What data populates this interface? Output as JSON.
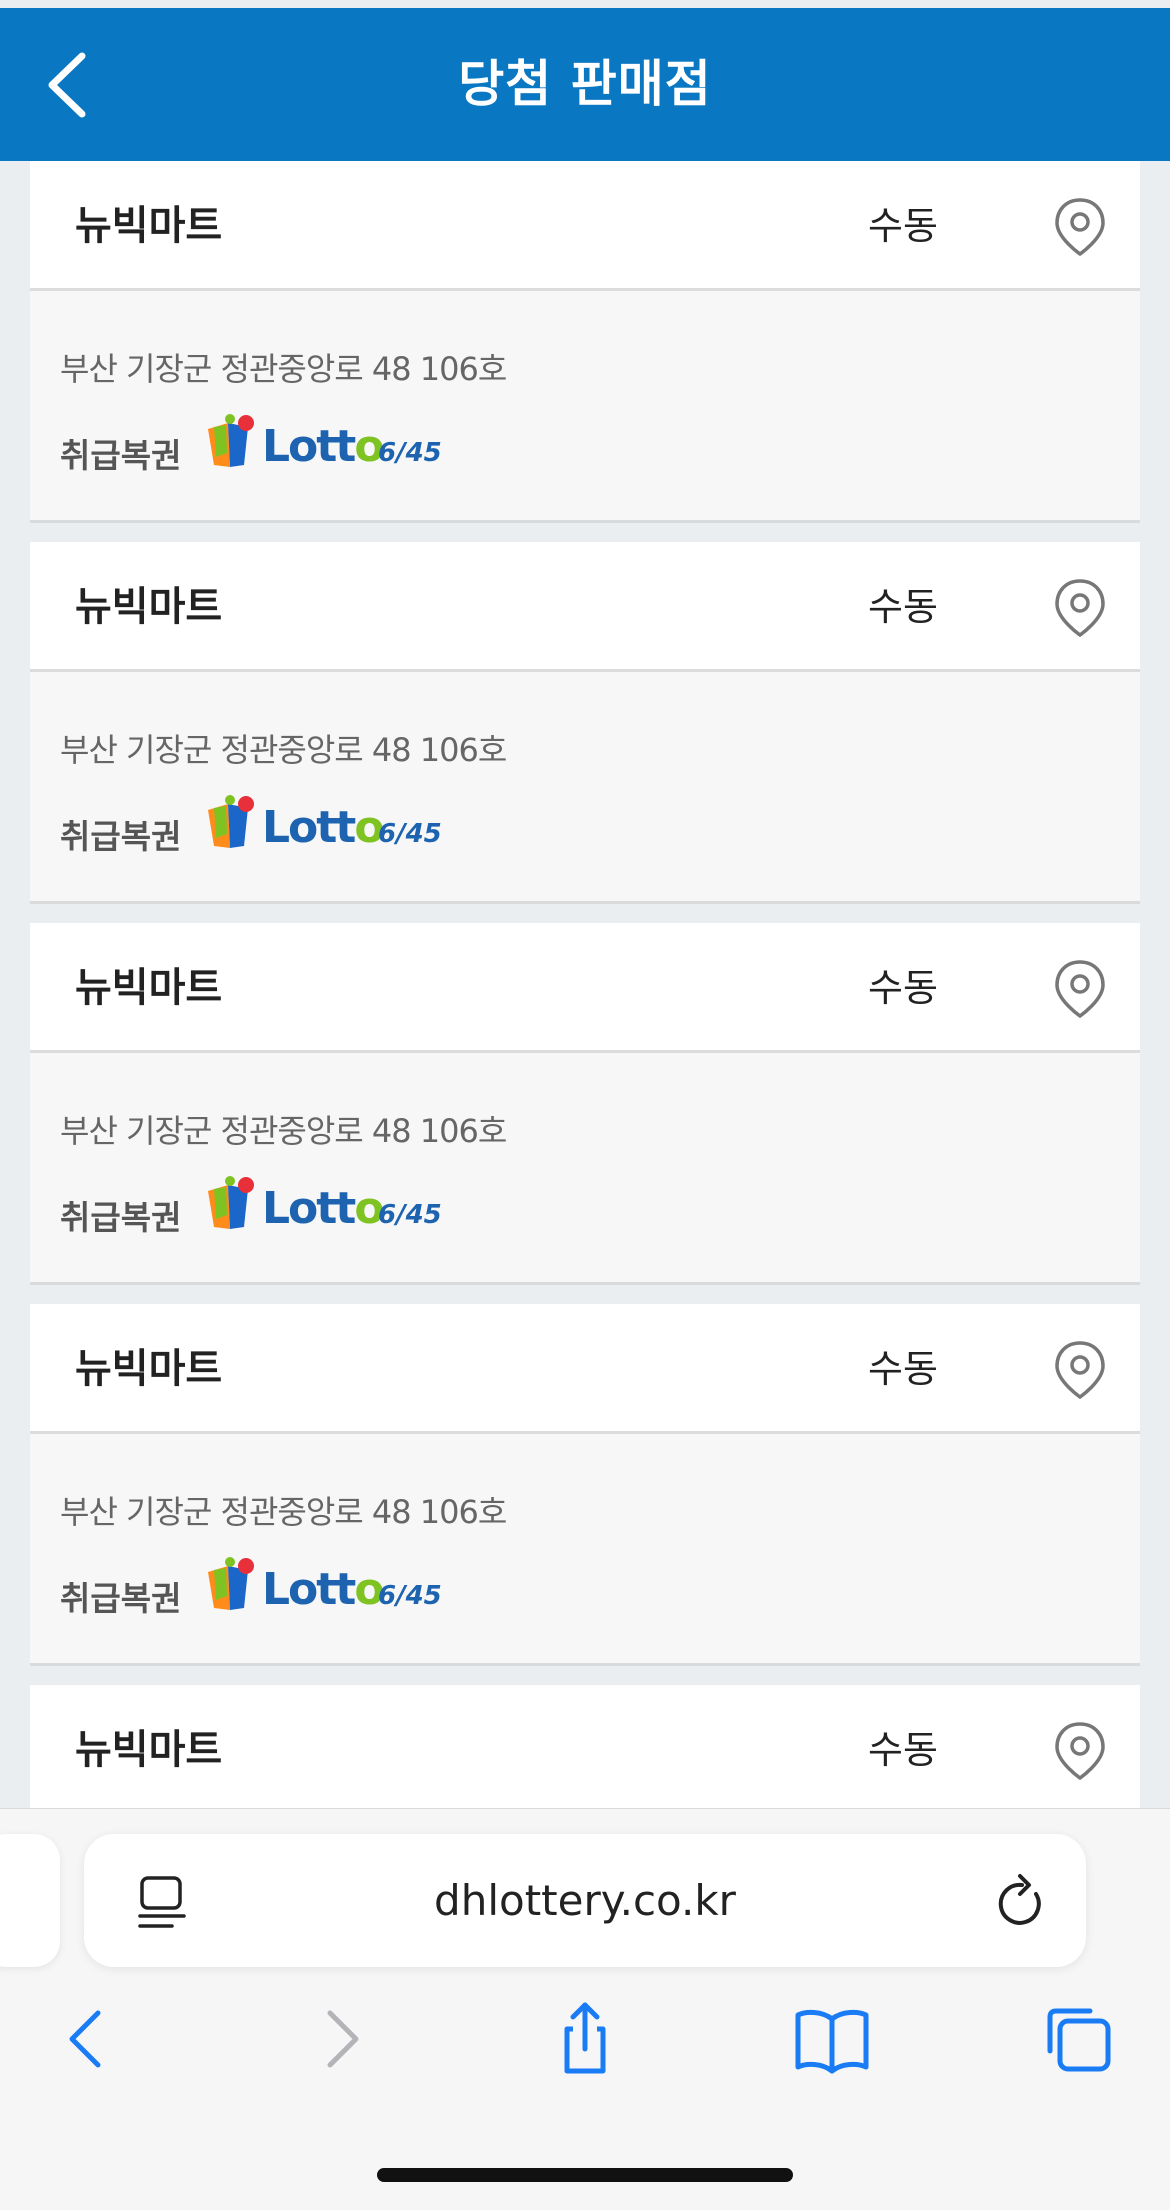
{
  "header": {
    "title": "당첨 판매점",
    "back_icon": "chevron-left-icon"
  },
  "stores": [
    {
      "name": "뉴빅마트",
      "method": "수동",
      "address": "부산 기장군 정관중앙로 48 106호",
      "ticket_label": "취급복권",
      "lottery_logo": {
        "word_main": "Lott",
        "word_o": "o",
        "sub": "6/45"
      }
    },
    {
      "name": "뉴빅마트",
      "method": "수동",
      "address": "부산 기장군 정관중앙로 48 106호",
      "ticket_label": "취급복권",
      "lottery_logo": {
        "word_main": "Lott",
        "word_o": "o",
        "sub": "6/45"
      }
    },
    {
      "name": "뉴빅마트",
      "method": "수동",
      "address": "부산 기장군 정관중앙로 48 106호",
      "ticket_label": "취급복권",
      "lottery_logo": {
        "word_main": "Lott",
        "word_o": "o",
        "sub": "6/45"
      }
    },
    {
      "name": "뉴빅마트",
      "method": "수동",
      "address": "부산 기장군 정관중앙로 48 106호",
      "ticket_label": "취급복권",
      "lottery_logo": {
        "word_main": "Lott",
        "word_o": "o",
        "sub": "6/45"
      }
    },
    {
      "name": "뉴빅마트",
      "method": "수동"
    }
  ],
  "browser": {
    "url": "dhlottery.co.kr",
    "icons": [
      "reader-icon",
      "reload-icon",
      "back-arrow-icon",
      "forward-arrow-icon",
      "share-icon",
      "bookmarks-icon",
      "tabs-icon"
    ]
  },
  "colors": {
    "header_bg": "#0a77c2",
    "accent_blue": "#1d63b0",
    "accent_green": "#7ec322",
    "safari_blue": "#1a7cf5"
  }
}
